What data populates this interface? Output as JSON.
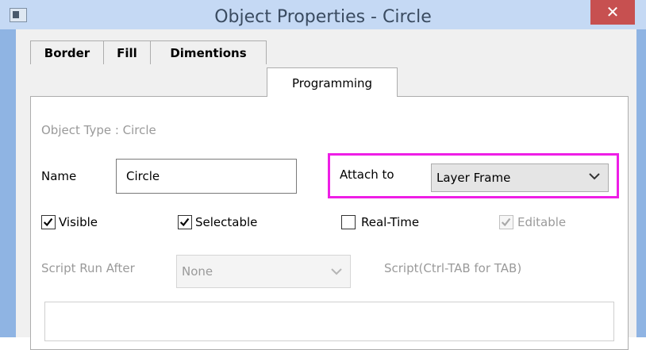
{
  "window": {
    "title": "Object Properties - Circle",
    "close_glyph": "✕"
  },
  "tabs": [
    {
      "label": "Border",
      "active": false
    },
    {
      "label": "Fill",
      "active": false
    },
    {
      "label": "Dimentions",
      "active": false
    },
    {
      "label": "Programming",
      "active": true
    }
  ],
  "programming": {
    "object_type": "Object Type : Circle",
    "name_label": "Name",
    "name_value": "Circle",
    "attach_label": "Attach to",
    "attach_value": "Layer Frame",
    "checkboxes": [
      {
        "label": "Visible",
        "checked": true,
        "enabled": true
      },
      {
        "label": "Selectable",
        "checked": true,
        "enabled": true
      },
      {
        "label": "Real-Time",
        "checked": false,
        "enabled": true
      },
      {
        "label": "Editable",
        "checked": true,
        "enabled": false
      }
    ],
    "script_run_label": "Script Run After",
    "script_run_value": "None",
    "script_label": "Script(Ctrl-TAB for TAB)"
  },
  "colors": {
    "highlight": "#ee1ee6",
    "close_button": "#c75050",
    "title_bar": "#c5d9f4"
  }
}
